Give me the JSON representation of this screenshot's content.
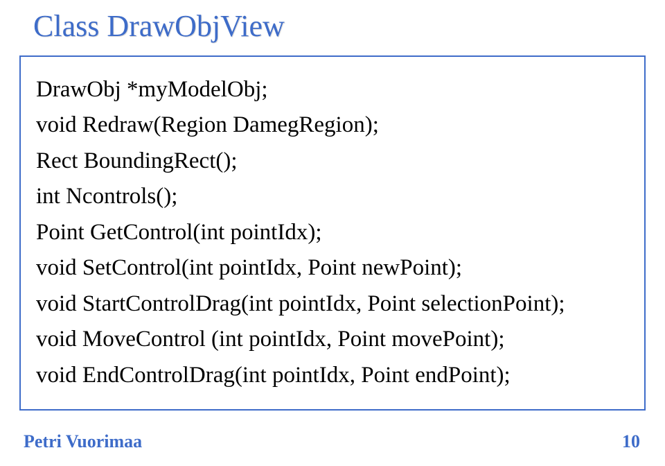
{
  "title": "Class DrawObjView",
  "lines": [
    "DrawObj *myModelObj;",
    "void Redraw(Region DamegRegion);",
    "Rect BoundingRect();",
    "int Ncontrols();",
    "Point GetControl(int pointIdx);",
    "void SetControl(int pointIdx, Point newPoint);",
    "void StartControlDrag(int pointIdx, Point selectionPoint);",
    "void MoveControl (int pointIdx, Point movePoint);",
    "void EndControlDrag(int pointIdx, Point endPoint);"
  ],
  "footer": {
    "author": "Petri Vuorimaa",
    "page": "10"
  }
}
